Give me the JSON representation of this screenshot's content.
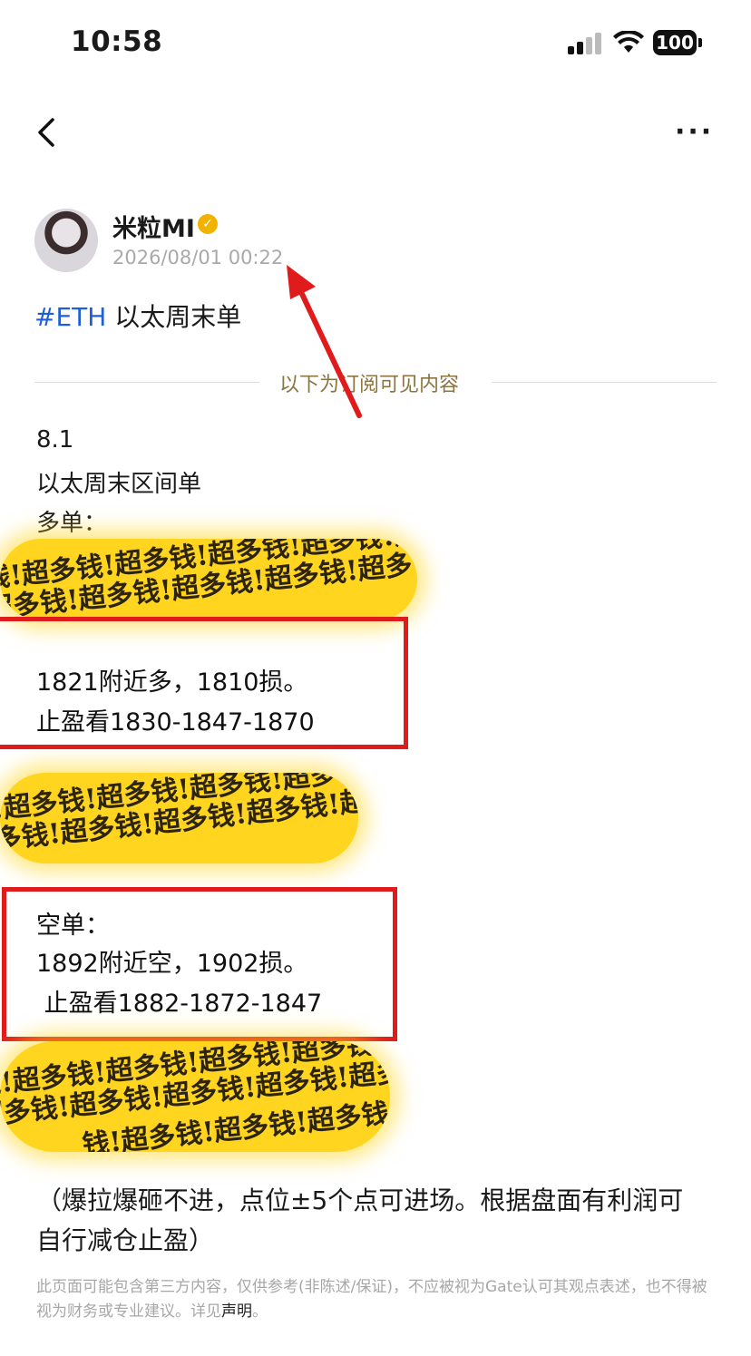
{
  "status_bar": {
    "time": "10:58",
    "battery": "100"
  },
  "nav": {
    "back_icon": "chevron-left-icon",
    "more_label": "···"
  },
  "author": {
    "name": "米粒MI",
    "verified_mark": "✓",
    "timestamp": "2026/08/01 00:22"
  },
  "post": {
    "topic_tag": "#ETH",
    "topic_title": " 以太周末单",
    "subscription_divider": "以下为订阅可见内容",
    "lines": [
      "8.1",
      "以太周末区间单",
      "多单："
    ],
    "long_box": {
      "line1": "1821附近多，1810损。",
      "line2": "止盈看1830-1847-1870"
    },
    "short_box": {
      "line1": "空单：",
      "line2": "1892附近空，1902损。",
      "line3": " 止盈看1882-1872-1847"
    },
    "watermark_text": "钱!超多钱!超多钱!超多钱!超多钱!超多",
    "note": "（爆拉爆砸不进，点位±5个点可进场。根据盘面有利润可自行减仓止盈）"
  },
  "disclaimer": {
    "text": "此页面可能包含第三方内容，仅供参考(非陈述/保证)，不应被视为Gate认可其观点表述，也不得被视为财务或专业建议。详见",
    "link": "声明",
    "end": "。"
  },
  "colors": {
    "highlight": "#ffd51f",
    "box_border": "#e01b1b",
    "arrow": "#e01b1b",
    "tag": "#1f5fd6",
    "divider_text": "#8b7540"
  }
}
